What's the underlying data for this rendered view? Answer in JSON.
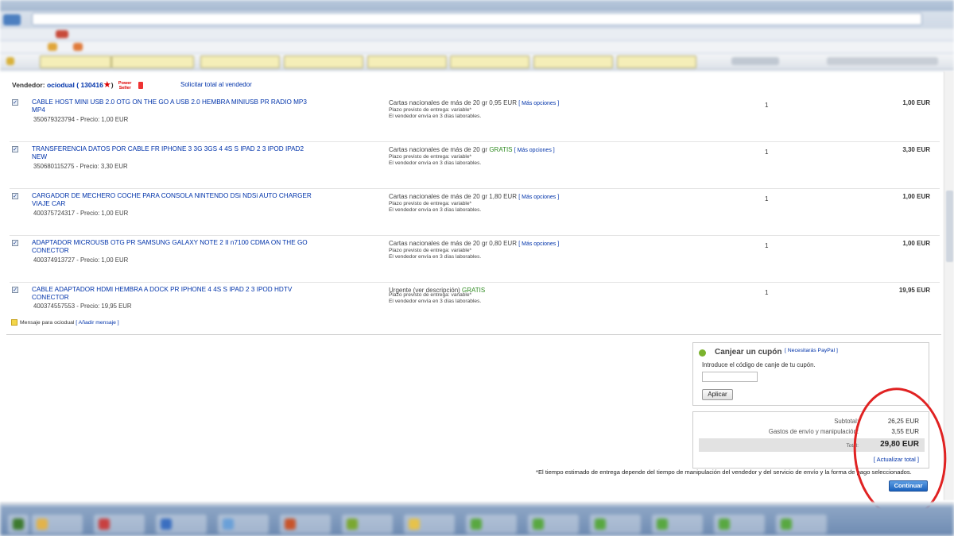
{
  "seller": {
    "label": "Vendedor:",
    "name": "ociodual",
    "feedback": "( 130416",
    "close_paren": ")",
    "badge_line1": "Power",
    "badge_line2": "Seller",
    "request_total": "Solicitar total al vendedor"
  },
  "items": [
    {
      "title": "CABLE HOST MINI USB 2.0 OTG ON THE GO A USB 2.0 HEMBRA MINIUSB PR RADIO MP3 MP4",
      "subtitle": "350679323794 - Precio: 1,00 EUR",
      "shipping": "Cartas nacionales de más de 20 gr 0,95 EUR",
      "free": "",
      "options": "[ Más opciones ]",
      "plazo": "Plazo previsto de entrega: variable*",
      "envia": "El vendedor envía en 3 días laborables.",
      "qty": "1",
      "price": "1,00 EUR"
    },
    {
      "title": "TRANSFERENCIA DATOS POR CABLE FR IPHONE 3 3G 3GS 4 4S S IPAD 2 3 IPOD IPAD2 NEW",
      "subtitle": "350680115275 - Precio: 3,30 EUR",
      "shipping": "Cartas nacionales de más de 20 gr",
      "free": "GRATIS",
      "options": "[ Más opciones ]",
      "plazo": "Plazo previsto de entrega: variable*",
      "envia": "El vendedor envía en 3 días laborables.",
      "qty": "1",
      "price": "3,30 EUR"
    },
    {
      "title": "CARGADOR DE MECHERO COCHE PARA CONSOLA NINTENDO DSi NDSi AUTO CHARGER VIAJE CAR",
      "subtitle": "400375724317 - Precio: 1,00 EUR",
      "shipping": "Cartas nacionales de más de 20 gr 1,80 EUR",
      "free": "",
      "options": "[ Más opciones ]",
      "plazo": "Plazo previsto de entrega: variable*",
      "envia": "El vendedor envía en 3 días laborables.",
      "qty": "1",
      "price": "1,00 EUR"
    },
    {
      "title": "ADAPTADOR MICROUSB OTG PR SAMSUNG GALAXY NOTE 2 II n7100 CDMA ON THE GO CONECTOR",
      "subtitle": "400374913727 - Precio: 1,00 EUR",
      "shipping": "Cartas nacionales de más de 20 gr 0,80 EUR",
      "free": "",
      "options": "[ Más opciones ]",
      "plazo": "Plazo previsto de entrega: variable*",
      "envia": "El vendedor envía en 3 días laborables.",
      "qty": "1",
      "price": "1,00 EUR"
    },
    {
      "title": "CABLE ADAPTADOR HDMI HEMBRA A DOCK PR IPHONE 4 4S S IPAD 2 3 IPOD HDTV CONECTOR",
      "subtitle": "400374557553 - Precio: 19,95 EUR",
      "shipping": "Urgente (ver descripción)",
      "free": "GRATIS",
      "options": "",
      "plazo": "Plazo previsto de entrega: variable*",
      "envia": "El vendedor envía en 3 días laborables.",
      "qty": "1",
      "price": "19,95 EUR"
    }
  ],
  "message": {
    "text": "Mensaje para ociodual",
    "link": "[ Añadir mensaje ]"
  },
  "coupon": {
    "title": "Canjear un cupón",
    "paypal_link": "[ Necesitarás PayPal ]",
    "description": "Introduce el código de canje de tu cupón.",
    "input_value": "",
    "apply_button": "Aplicar"
  },
  "totals": {
    "subtotal_label": "Subtotal:",
    "subtotal_value": "26,25 EUR",
    "shipping_label": "Gastos de envío y manipulación:",
    "shipping_value": "3,55 EUR",
    "total_label": "Total:",
    "total_value": "29,80 EUR",
    "update_link": "[ Actualizar total ]"
  },
  "note": "*El tiempo estimado de entrega depende del tiempo de manipulación del vendedor y del servicio de envío y la forma de pago seleccionados.",
  "continue_button": "Continuar",
  "colors": {
    "link": "#0033aa",
    "free": "#2d8a1f",
    "continue": "#1a62bd",
    "annotation": "#e02222"
  }
}
